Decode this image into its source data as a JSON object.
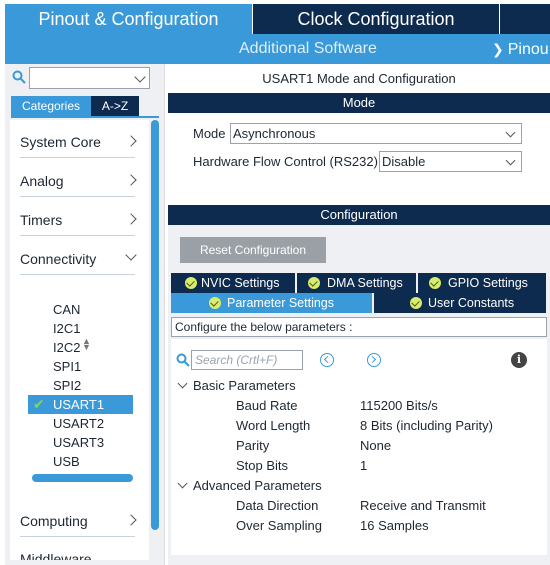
{
  "header": {
    "tab_pinout": "Pinout & Configuration",
    "tab_clock": "Clock Configuration",
    "sub_additional": "Additional Software",
    "sub_pinout": "Pinou"
  },
  "categories": {
    "search_value": "",
    "tab_categories": "Categories",
    "tab_az": "A->Z",
    "items": [
      {
        "label": "System Core"
      },
      {
        "label": "Analog"
      },
      {
        "label": "Timers"
      },
      {
        "label": "Connectivity"
      },
      {
        "label": "Computing"
      },
      {
        "label": "Middleware"
      }
    ],
    "connectivity_items": [
      "CAN",
      "I2C1",
      "I2C2",
      "SPI1",
      "SPI2",
      "USART1",
      "USART2",
      "USART3",
      "USB"
    ],
    "selected": "USART1"
  },
  "mode": {
    "title": "USART1 Mode and Configuration",
    "section": "Mode",
    "mode_label": "Mode",
    "mode_value": "Asynchronous",
    "flow_label": "Hardware Flow Control (RS232)",
    "flow_value": "Disable"
  },
  "configuration": {
    "section": "Configuration",
    "reset_button": "Reset Configuration",
    "tabs": {
      "nvic": "NVIC Settings",
      "dma": "DMA Settings",
      "gpio": "GPIO Settings",
      "param": "Parameter Settings",
      "user": "User Constants"
    },
    "configure_text": "Configure the below parameters :",
    "search_placeholder": "Search (Crtl+F)",
    "groups": [
      {
        "name": "Basic Parameters",
        "params": [
          {
            "name": "Baud Rate",
            "value": "115200 Bits/s"
          },
          {
            "name": "Word Length",
            "value": "8 Bits (including Parity)"
          },
          {
            "name": "Parity",
            "value": "None"
          },
          {
            "name": "Stop Bits",
            "value": "1"
          }
        ]
      },
      {
        "name": "Advanced Parameters",
        "params": [
          {
            "name": "Data Direction",
            "value": "Receive and Transmit"
          },
          {
            "name": "Over Sampling",
            "value": "16 Samples"
          }
        ]
      }
    ]
  },
  "colors": {
    "accent": "#3a9ad9",
    "dark": "#0d2a4f",
    "check_green": "#8bd34a"
  }
}
